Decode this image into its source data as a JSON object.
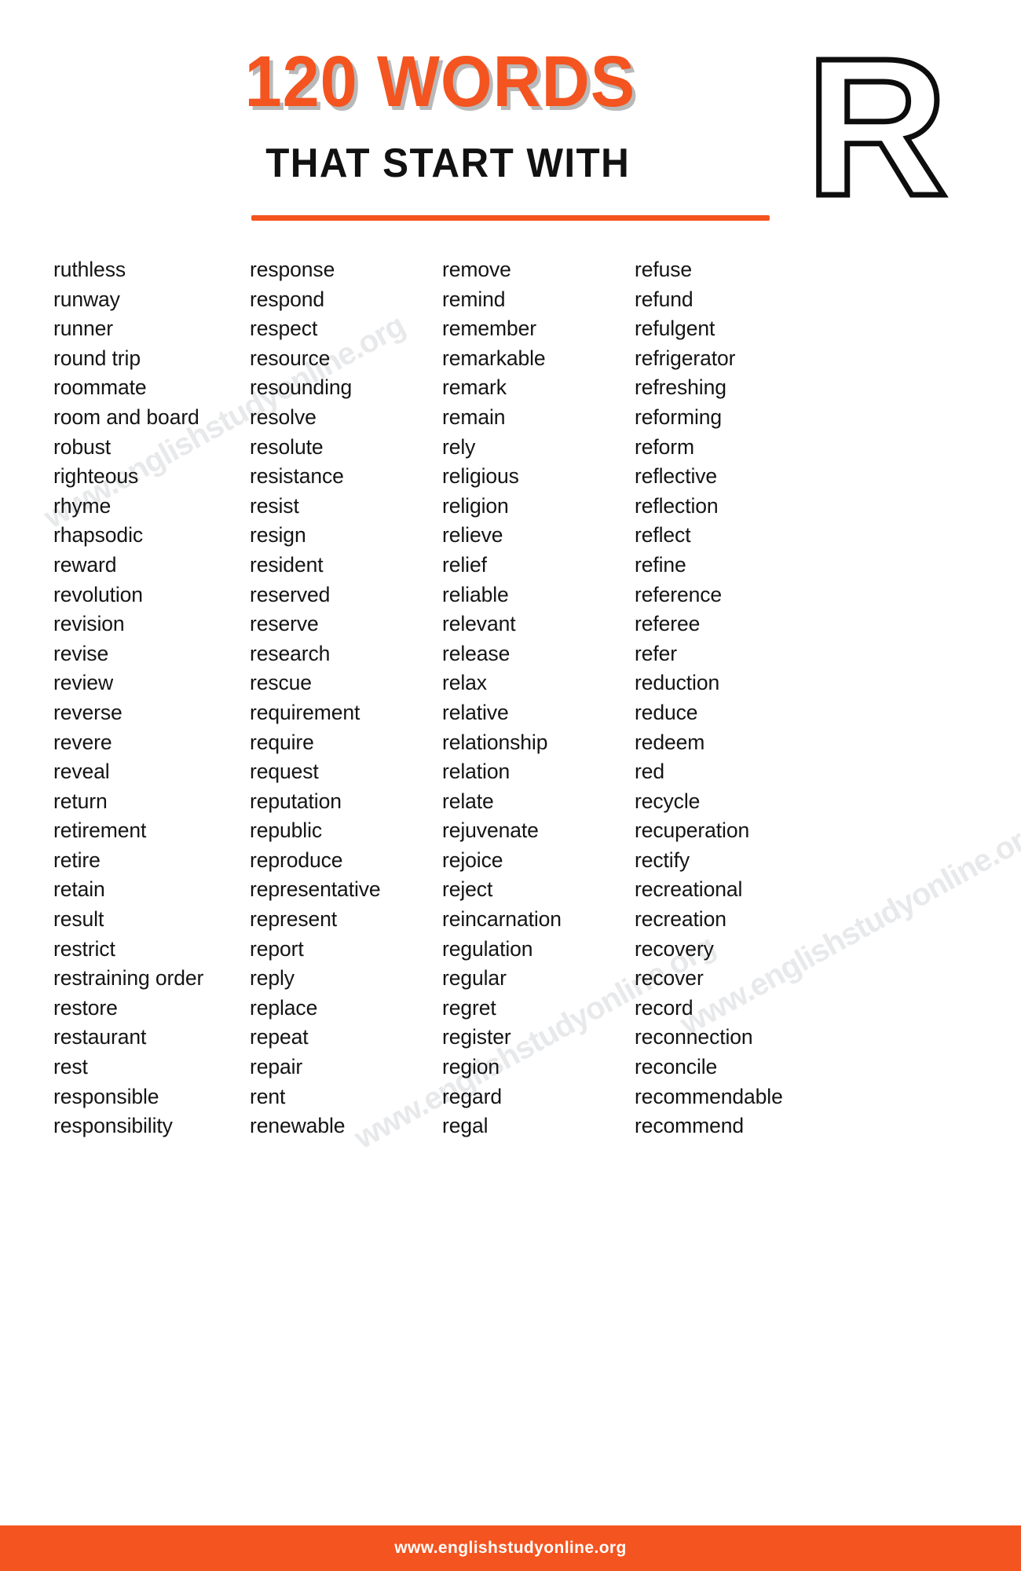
{
  "header": {
    "count_title": "120 WORDS",
    "subtitle": "THAT START WITH",
    "letter": "R",
    "accent_color": "#F4541F",
    "title_shadow_color": "#808080",
    "subtitle_color": "#111111"
  },
  "watermarks": {
    "text": "www.englishstudyonline.org",
    "color": "#969BA5"
  },
  "footer": {
    "url": "www.englishstudyonline.org",
    "background_color": "#F4541F",
    "text_color": "#FFFFFF"
  },
  "word_list": {
    "total": 120,
    "columns": [
      {
        "index": 1,
        "words": [
          "ruthless",
          "runway",
          "runner",
          "round trip",
          "roommate",
          "room and board",
          "robust",
          "righteous",
          "rhyme",
          "rhapsodic",
          "reward",
          "revolution",
          "revision",
          "revise",
          "review",
          "reverse",
          "revere",
          "reveal",
          "return",
          "retirement",
          "retire",
          "retain",
          "result",
          "restrict",
          "restraining order",
          "restore",
          "restaurant",
          "rest",
          "responsible",
          "responsibility"
        ]
      },
      {
        "index": 2,
        "words": [
          "response",
          "respond",
          "respect",
          "resource",
          "resounding",
          "resolve",
          "resolute",
          "resistance",
          "resist",
          "resign",
          "resident",
          "reserved",
          "reserve",
          "research",
          "rescue",
          "requirement",
          "require",
          "request",
          "reputation",
          "republic",
          "reproduce",
          "representative",
          "represent",
          "report",
          "reply",
          "replace",
          "repeat",
          "repair",
          "rent",
          "renewable"
        ]
      },
      {
        "index": 3,
        "words": [
          "remove",
          "remind",
          "remember",
          "remarkable",
          "remark",
          "remain",
          "rely",
          "religious",
          "religion",
          "relieve",
          "relief",
          "reliable",
          "relevant",
          "release",
          "relax",
          "relative",
          "relationship",
          "relation",
          "relate",
          "rejuvenate",
          "rejoice",
          "reject",
          "reincarnation",
          "regulation",
          "regular",
          "regret",
          "register",
          "region",
          "regard",
          "regal"
        ]
      },
      {
        "index": 4,
        "words": [
          "refuse",
          "refund",
          "refulgent",
          "refrigerator",
          "refreshing",
          "reforming",
          "reform",
          "reflective",
          "reflection",
          "reflect",
          "refine",
          "reference",
          "referee",
          "refer",
          "reduction",
          "reduce",
          "redeem",
          "red",
          "recycle",
          "recuperation",
          "rectify",
          "recreational",
          "recreation",
          "recovery",
          "recover",
          "record",
          "reconnection",
          "reconcile",
          "recommendable",
          "recommend"
        ]
      }
    ]
  }
}
